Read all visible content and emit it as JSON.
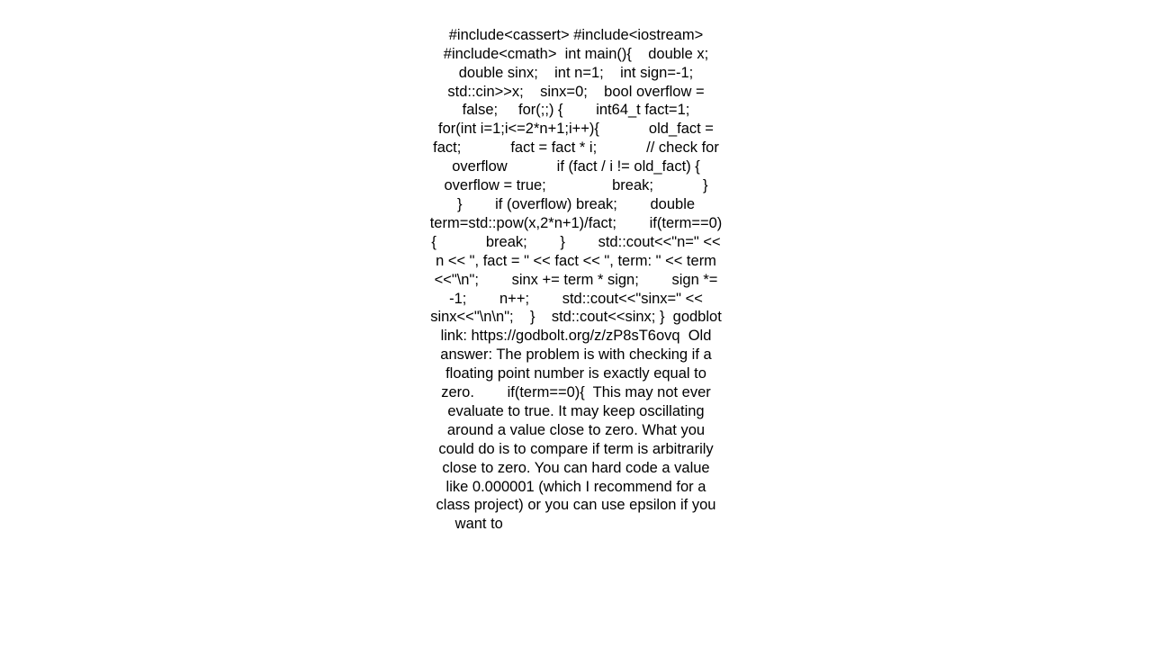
{
  "page": {
    "background_color": "#ffffff",
    "text_color": "#000000",
    "alignment": "center"
  },
  "answer": {
    "code_intro": "#include<cassert> #include<iostream> #include<cmath>  int main(){    double x;    double sinx;    int n=1;    int sign=-1;    std::cin>>x;    sinx=0;    bool overflow = false;     for(;;) {        int64_t fact=1;        for(int i=1;i<=2*n+1;i++){            old_fact = fact;            fact = fact * i;            // check for overflow            if (fact / i != old_fact) {                overflow = true;                break;            }        }        if (overflow) break;        double term=std::pow(x,2*n+1)/fact;        if(term==0){            break;        }        std::cout<<\"n=\" << n << \", fact = \" << fact << \", term: \" << term <<\"\\n\";        sinx += term * sign;        sign *= -1;        n++;        std::cout<<\"sinx=\" << sinx<<\"\\n\\n\";    }    std::cout<<sinx; }",
    "link_label": "godblot link:",
    "link_url": "https://godbolt.org/z/zP8sT6ovq",
    "old_answer_label": "Old answer:",
    "explanation_part1": "The problem is with checking if a floating point number is exactly equal to zero.",
    "inline_code": "if(term==0){",
    "explanation_part2": "This may not ever evaluate to true. It may keep oscillating around a value close to zero. What you could do is to compare if term is arbitrarily close to zero. You can hard code a value like 0.000001 (which I recommend for a class project) or you can use epsilon if you want to",
    "full_text": "#include<cassert> #include<iostream> #include<cmath>  int main(){    double x;    double sinx;    int n=1;    int sign=-1;    std::cin>>x;    sinx=0;    bool overflow = false;     for(;;) {        int64_t fact=1;        for(int i=1;i<=2*n+1;i++){            old_fact = fact;            fact = fact * i;            // check for overflow            if (fact / i != old_fact) {                overflow = true;                break;            }        }        if (overflow) break;        double term=std::pow(x,2*n+1)/fact;        if(term==0){            break;        }        std::cout<<\"n=\" << n << \", fact = \" << fact << \", term: \" << term <<\"\\n\";        sinx += term * sign;        sign *= -1;        n++;        std::cout<<\"sinx=\" << sinx<<\"\\n\\n\";    }    std::cout<<sinx; }  godblot link: https://godbolt.org/z/zP8sT6ovq  Old answer: The problem is with checking if a floating point number is exactly equal to zero.        if(term==0){  This may not ever evaluate to true. It may keep oscillating around a value close to zero. What you could do is to compare if term is arbitrarily close to zero. You can hard code a value like 0.000001 (which I recommend for a class project) or you can use epsilon if you want to                                               "
  }
}
